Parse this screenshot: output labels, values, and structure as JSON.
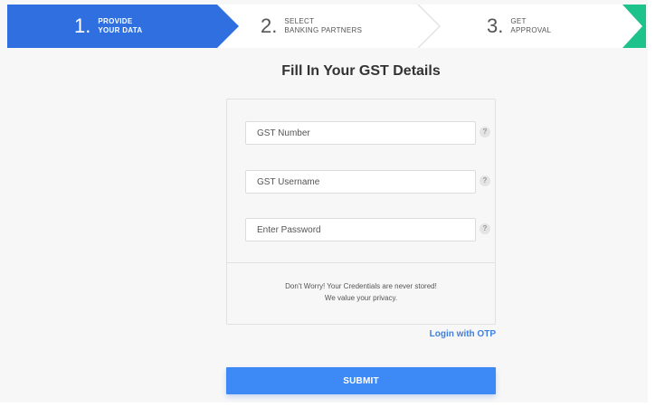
{
  "stepper": {
    "steps": [
      {
        "number": "1.",
        "line1": "PROVIDE",
        "line2": "YOUR DATA"
      },
      {
        "number": "2.",
        "line1": "SELECT",
        "line2": "BANKING PARTNERS"
      },
      {
        "number": "3.",
        "line1": "GET",
        "line2": "APPROVAL"
      }
    ],
    "active_step": 1,
    "colors": {
      "active": "#2f6fe0",
      "accent_green": "#1ec28b"
    }
  },
  "form": {
    "title": "Fill In Your GST Details",
    "fields": [
      {
        "placeholder": "GST Number",
        "value": ""
      },
      {
        "placeholder": "GST Username",
        "value": ""
      },
      {
        "placeholder": "Enter Password",
        "value": ""
      }
    ],
    "help_glyph": "?",
    "note_line1": "Don't Worry! Your Credentials are never stored!",
    "note_line2": "We value your privacy.",
    "otp_link": "Login with OTP",
    "submit_label": "SUBMIT"
  }
}
